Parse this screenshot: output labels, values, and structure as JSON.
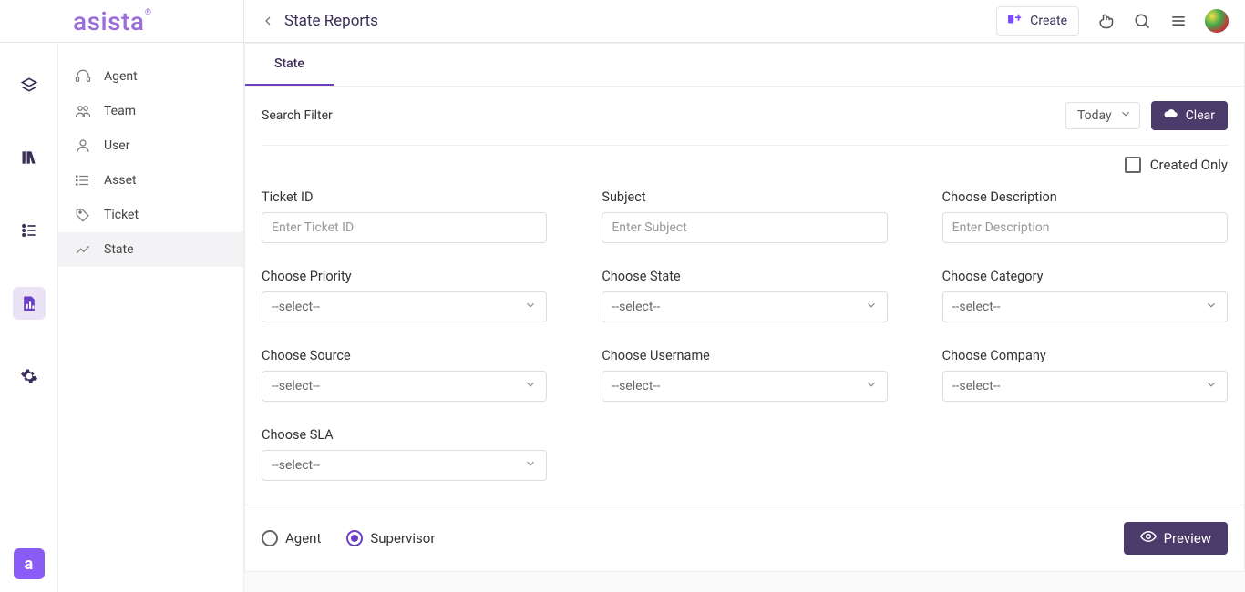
{
  "header": {
    "logo": "asista",
    "page_title": "State Reports",
    "create_label": "Create"
  },
  "sidebar": {
    "items": [
      {
        "label": "Agent"
      },
      {
        "label": "Team"
      },
      {
        "label": "User"
      },
      {
        "label": "Asset"
      },
      {
        "label": "Ticket"
      },
      {
        "label": "State"
      }
    ]
  },
  "tabs": {
    "state": "State"
  },
  "filter": {
    "title": "Search Filter",
    "today": "Today",
    "clear": "Clear",
    "created_only": "Created Only",
    "fields": {
      "ticket_id": {
        "label": "Ticket ID",
        "placeholder": "Enter Ticket ID"
      },
      "subject": {
        "label": "Subject",
        "placeholder": "Enter Subject"
      },
      "description": {
        "label": "Choose Description",
        "placeholder": "Enter Description"
      },
      "priority": {
        "label": "Choose Priority",
        "placeholder": "--select--"
      },
      "state": {
        "label": "Choose State",
        "placeholder": "--select--"
      },
      "category": {
        "label": "Choose Category",
        "placeholder": "--select--"
      },
      "source": {
        "label": "Choose Source",
        "placeholder": "--select--"
      },
      "username": {
        "label": "Choose Username",
        "placeholder": "--select--"
      },
      "company": {
        "label": "Choose Company",
        "placeholder": "--select--"
      },
      "sla": {
        "label": "Choose SLA",
        "placeholder": "--select--"
      }
    }
  },
  "footer": {
    "agent": "Agent",
    "supervisor": "Supervisor",
    "preview": "Preview"
  }
}
